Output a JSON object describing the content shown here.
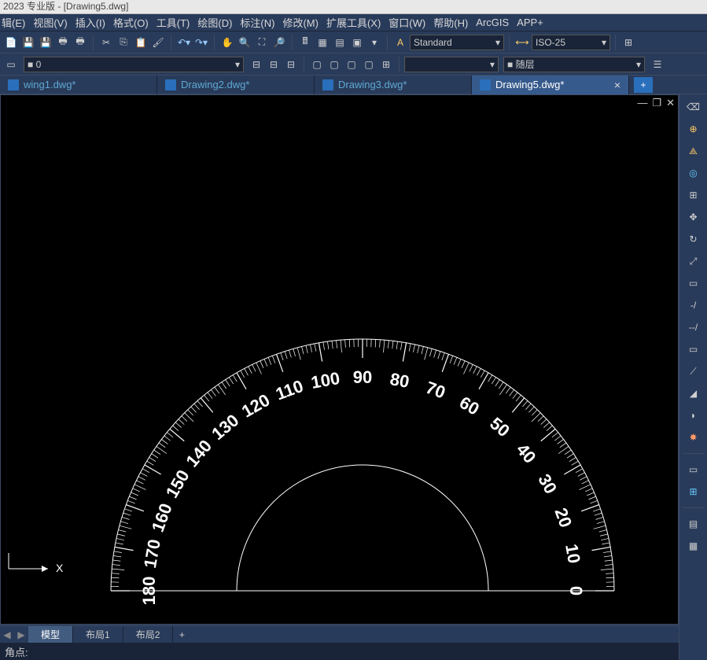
{
  "title": "2023 专业版 - [Drawing5.dwg]",
  "menu": [
    "辑(E)",
    "视图(V)",
    "插入(I)",
    "格式(O)",
    "工具(T)",
    "绘图(D)",
    "标注(N)",
    "修改(M)",
    "扩展工具(X)",
    "窗口(W)",
    "帮助(H)",
    "ArcGIS",
    "APP+"
  ],
  "style_sel": "Standard",
  "dim_sel": "ISO-25",
  "layer_sel": "0",
  "bylayer_sel": "随层",
  "tabs": [
    {
      "label": "wing1.dwg*",
      "active": false
    },
    {
      "label": "Drawing2.dwg*",
      "active": false
    },
    {
      "label": "Drawing3.dwg*",
      "active": false
    },
    {
      "label": "Drawing5.dwg*",
      "active": true
    }
  ],
  "bottom_tabs": {
    "model": "模型",
    "layout1": "布局1",
    "layout2": "布局2"
  },
  "cmd_prompt": "角点:",
  "ucs_label": "X",
  "chart_data": {
    "type": "protractor",
    "outer_radius": 320,
    "inner_radius": 160,
    "center": [
      330,
      480
    ],
    "angle_range": [
      0,
      180
    ],
    "major_ticks": [
      0,
      10,
      20,
      30,
      40,
      50,
      60,
      70,
      80,
      90,
      100,
      110,
      120,
      130,
      140,
      150,
      160,
      170,
      180
    ],
    "minor_step": 1,
    "labeled_values": [
      0,
      10,
      20,
      30,
      40,
      50,
      60,
      70,
      80,
      90,
      100,
      110,
      120,
      130,
      140,
      150,
      160,
      170,
      180
    ]
  }
}
